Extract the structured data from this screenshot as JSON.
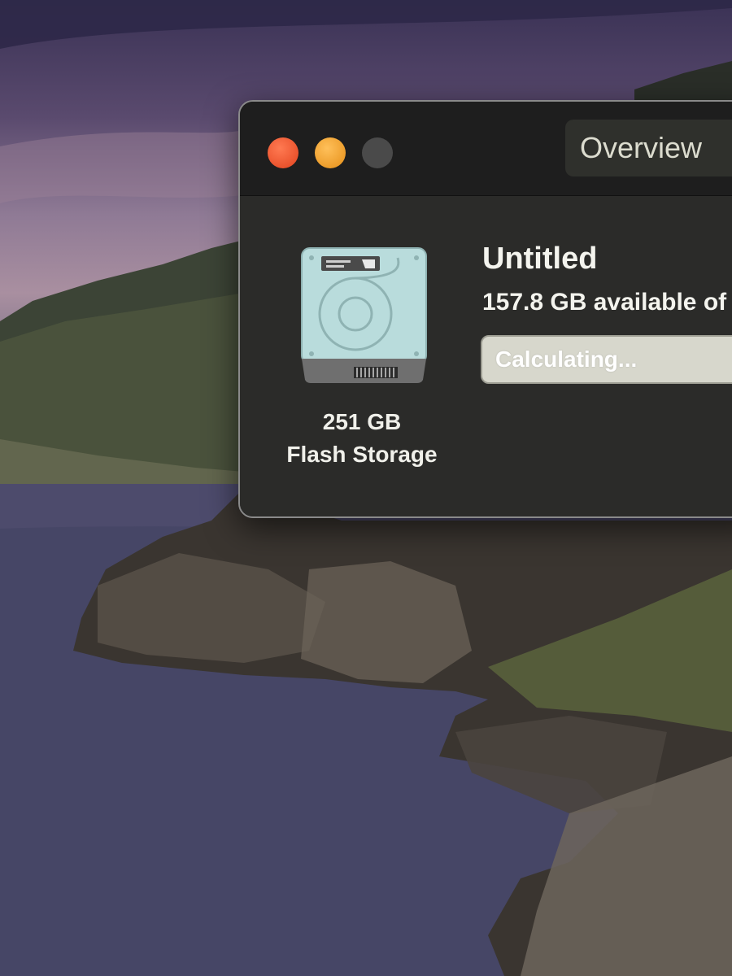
{
  "window": {
    "tabs": [
      {
        "label": "Overview"
      }
    ]
  },
  "disk": {
    "size": "251 GB",
    "type": "Flash Storage",
    "icon": "hard-drive-icon"
  },
  "volume": {
    "name": "Untitled",
    "available_text": "157.8 GB available of",
    "status_text": "Calculating..."
  },
  "colors": {
    "close": "#e2431e",
    "minimize": "#e58e17",
    "zoom_disabled": "#4a4a4a",
    "window_bg": "#262626"
  }
}
